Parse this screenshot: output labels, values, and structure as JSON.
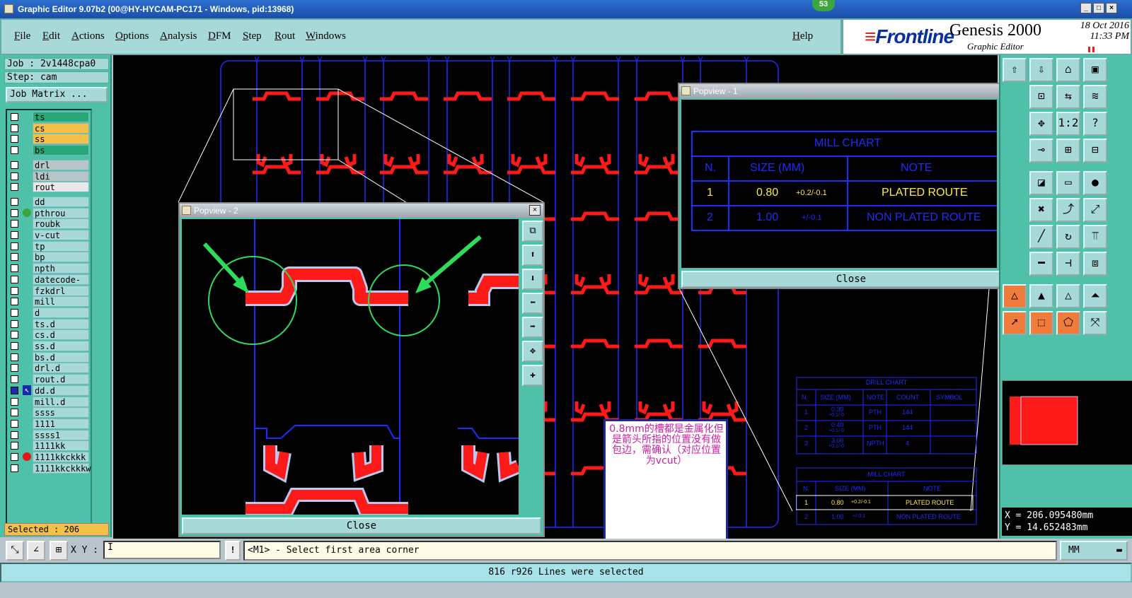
{
  "window": {
    "title": "Graphic Editor 9.07b2 (00@HY-HYCAM-PC171 - Windows, pid:13968)",
    "badge": "53"
  },
  "menu": [
    "File",
    "Edit",
    "Actions",
    "Options",
    "Analysis",
    "DFM",
    "Step",
    "Rout",
    "Windows"
  ],
  "help_label": "Help",
  "brand": {
    "logo": "Frontline",
    "product": "Genesis 2000",
    "subtitle": "Graphic Editor",
    "date": "18 Oct 2016",
    "time": "11:33 PM"
  },
  "job": {
    "job": "Job : 2v1448cpa0",
    "step": "Step: cam",
    "matrix_button": "Job Matrix ..."
  },
  "layers": [
    {
      "name": "ts",
      "color": "#28a878",
      "dot": ""
    },
    {
      "name": "cs",
      "color": "#f4c048",
      "dot": ""
    },
    {
      "name": "ss",
      "color": "#f4c048",
      "dot": ""
    },
    {
      "name": "bs",
      "color": "#28a878",
      "dot": ""
    },
    {
      "name": "drl",
      "color": "#b7c4c8",
      "dot": ""
    },
    {
      "name": "ldi",
      "color": "#b7c4c8",
      "dot": ""
    },
    {
      "name": "rout",
      "color": "#e8e8e8",
      "dot": ""
    },
    {
      "name": "dd",
      "color": "#a7d9d9",
      "dot": ""
    },
    {
      "name": "pthrou",
      "color": "#a7d9d9",
      "dot": "#3aa53a"
    },
    {
      "name": "roubk",
      "color": "#a7d9d9",
      "dot": ""
    },
    {
      "name": "v-cut",
      "color": "#a7d9d9",
      "dot": ""
    },
    {
      "name": "tp",
      "color": "#a7d9d9",
      "dot": ""
    },
    {
      "name": "bp",
      "color": "#a7d9d9",
      "dot": ""
    },
    {
      "name": "npth",
      "color": "#a7d9d9",
      "dot": ""
    },
    {
      "name": "datecode-ss",
      "color": "#a7d9d9",
      "dot": ""
    },
    {
      "name": "fzkdrl",
      "color": "#a7d9d9",
      "dot": ""
    },
    {
      "name": "mill",
      "color": "#a7d9d9",
      "dot": ""
    },
    {
      "name": "d",
      "color": "#a7d9d9",
      "dot": ""
    },
    {
      "name": "ts.d",
      "color": "#a7d9d9",
      "dot": ""
    },
    {
      "name": "cs.d",
      "color": "#a7d9d9",
      "dot": ""
    },
    {
      "name": "ss.d",
      "color": "#a7d9d9",
      "dot": ""
    },
    {
      "name": "bs.d",
      "color": "#a7d9d9",
      "dot": ""
    },
    {
      "name": "drl.d",
      "color": "#a7d9d9",
      "dot": ""
    },
    {
      "name": "rout.d",
      "color": "#a7d9d9",
      "dot": ""
    },
    {
      "name": "dd.d",
      "color": "#a7d9d9",
      "dot": "arrow"
    },
    {
      "name": "mill.d",
      "color": "#a7d9d9",
      "dot": ""
    },
    {
      "name": "ssss",
      "color": "#a7d9d9",
      "dot": ""
    },
    {
      "name": "1111",
      "color": "#a7d9d9",
      "dot": ""
    },
    {
      "name": "ssss1",
      "color": "#a7d9d9",
      "dot": ""
    },
    {
      "name": "1111kk",
      "color": "#a7d9d9",
      "dot": ""
    },
    {
      "name": "1111kkckkk",
      "color": "#a7d9d9",
      "dot": "#e01818"
    },
    {
      "name": "1111kkckkkw",
      "color": "#a7d9d9",
      "dot": ""
    }
  ],
  "selected": "Selected : 206",
  "popview1": {
    "title": "Popview - 1",
    "chart_title": "MILL CHART",
    "headers": [
      "N.",
      "SIZE (MM)",
      "NOTE"
    ],
    "rows": [
      {
        "n": "1",
        "size": "0.80",
        "tol": "+0.2/-0.1",
        "note": "PLATED ROUTE"
      },
      {
        "n": "2",
        "size": "1.00",
        "tol": "+/-0.1",
        "note": "NON PLATED ROUTE"
      }
    ],
    "close": "Close"
  },
  "popview2": {
    "title": "Popview - 2",
    "close": "Close"
  },
  "drill_chart": {
    "title": "DRILL CHART",
    "headers": [
      "N.",
      "SIZE (MM)",
      "NOTE",
      "COUNT",
      "SYMBOL"
    ],
    "rows": [
      {
        "n": "1",
        "size": "0.30",
        "tol": "+0.1/-0",
        "note": "PTH",
        "count": "144"
      },
      {
        "n": "2",
        "size": "0.40",
        "tol": "+0.1/-0",
        "note": "PTH",
        "count": "144"
      },
      {
        "n": "3",
        "size": "3.00",
        "tol": "+0.1/-0",
        "note": "NPTH",
        "count": "4"
      }
    ]
  },
  "mill_chart_small": {
    "title": "MILL CHART",
    "headers": [
      "N.",
      "SIZE (MM)",
      "NOTE"
    ],
    "rows": [
      {
        "n": "1",
        "size": "0.80",
        "tol": "+0.2/-0.1",
        "note": "PLATED ROUTE"
      },
      {
        "n": "2",
        "size": "1.00",
        "tol": "+/-0.1",
        "note": "NON PLATED ROUTE"
      }
    ]
  },
  "note": "0.8mm的槽都是金属化但是箭头所指的位置没有做包边，需确认（对应位置为vcut）",
  "coords": {
    "x": "X = 206.095480mm",
    "y": "Y = 14.652483mm"
  },
  "command": {
    "xy_label": "X Y :",
    "xy_value": "I",
    "prompt": "<M1> - Select first area corner",
    "units": "MM"
  },
  "status": "816 r926 Lines were selected",
  "colors": {
    "cad_red": "#ff1a1a",
    "cad_blue": "#1e2cff",
    "pad_silver": "#b8c8f0",
    "teal": "#4fc1a8"
  }
}
